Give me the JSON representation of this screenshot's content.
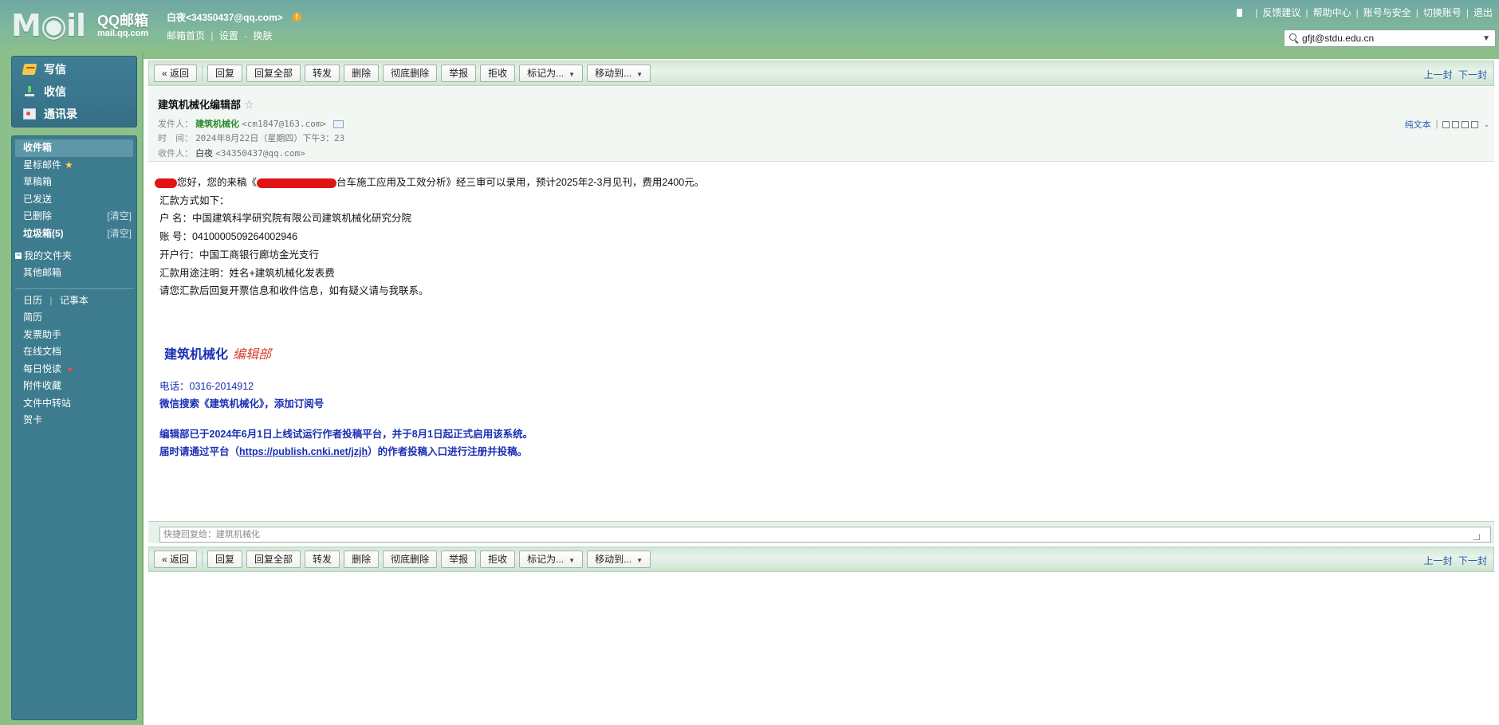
{
  "header": {
    "logo_main": "M◉il",
    "logo_brand": "QQ邮箱",
    "logo_domain": "mail.qq.com",
    "user_display": "白夜<34350437@qq.com>",
    "user_links": [
      "邮箱首页",
      "设置",
      "换肤"
    ],
    "top_links": [
      "反馈建议",
      "帮助中心",
      "账号与安全",
      "切换账号",
      "退出"
    ],
    "search_value": "gfjt@stdu.edu.cn"
  },
  "sidebar": {
    "compose": "写信",
    "receive": "收信",
    "contacts": "通讯录",
    "inbox": "收件箱",
    "starred": "星标邮件",
    "drafts": "草稿箱",
    "sent": "已发送",
    "deleted": "已删除",
    "clear": "[清空]",
    "spam": "垃圾箱(5)",
    "my_folders": "我的文件夹",
    "other_mailbox": "其他邮箱",
    "calendar": "日历",
    "notebook": "记事本",
    "resume": "简历",
    "invoice_assistant": "发票助手",
    "online_docs": "在线文档",
    "daily_reading": "每日悦读",
    "attachments": "附件收藏",
    "file_transfer": "文件中转站",
    "greeting_card": "贺卡"
  },
  "toolbar": {
    "back": "« 返回",
    "reply": "回复",
    "reply_all": "回复全部",
    "forward": "转发",
    "delete": "删除",
    "delete_permanent": "彻底删除",
    "report": "举报",
    "reject": "拒收",
    "mark_as": "标记为...",
    "move_to": "移动到...",
    "prev": "上一封",
    "next": "下一封"
  },
  "mail": {
    "subject": "建筑机械化编辑部",
    "sender_label": "发件人：",
    "sender_name": "建筑机械化",
    "sender_email": "<cm1847@163.com>",
    "time_label": "时　间：",
    "time_value": "2024年8月22日（星期四）下午3：23",
    "recipient_label": "收件人：",
    "recipient_name": "白夜",
    "recipient_email": "<34350437@qq.com>",
    "plain_text": "纯文本",
    "body": {
      "line1_a": "您好，您的来稿《",
      "line1_b": "台车施工应用及工效分析》经三审可以录用，预计2025年2-3月见刊，费用2400元。",
      "line2": "汇款方式如下：",
      "line3": "户 名：中国建筑科学研究院有限公司建筑机械化研究分院",
      "line4": "账 号：0410000509264002946",
      "line5": "开户行：中国工商银行廊坊金光支行",
      "line6": "汇款用途注明：姓名+建筑机械化发表费",
      "line7": "请您汇款后回复开票信息和收件信息，如有疑义请与我联系。"
    },
    "signature": {
      "title": "建筑机械化",
      "subtitle": "编辑部",
      "phone": "电话：0316-2014912",
      "wechat": "微信搜索《建筑机械化》，添加订阅号",
      "notice1": "编辑部已于2024年6月1日上线试运行作者投稿平台，并于8月1日起正式启用该系统。",
      "notice2_a": "届时请通过平台（",
      "notice2_link": "https://publish.cnki.net/jzjh",
      "notice2_b": "）的作者投稿入口进行注册并投稿。"
    }
  },
  "quick_reply": {
    "placeholder": "快捷回复给：建筑机械化"
  },
  "colors": {
    "header_green": "#7fb79b",
    "sidebar_blue": "#3d7b8e",
    "signature_blue": "#1a2fb5",
    "signature_red": "#d63a2f",
    "sender_green": "#2e8a2e"
  }
}
